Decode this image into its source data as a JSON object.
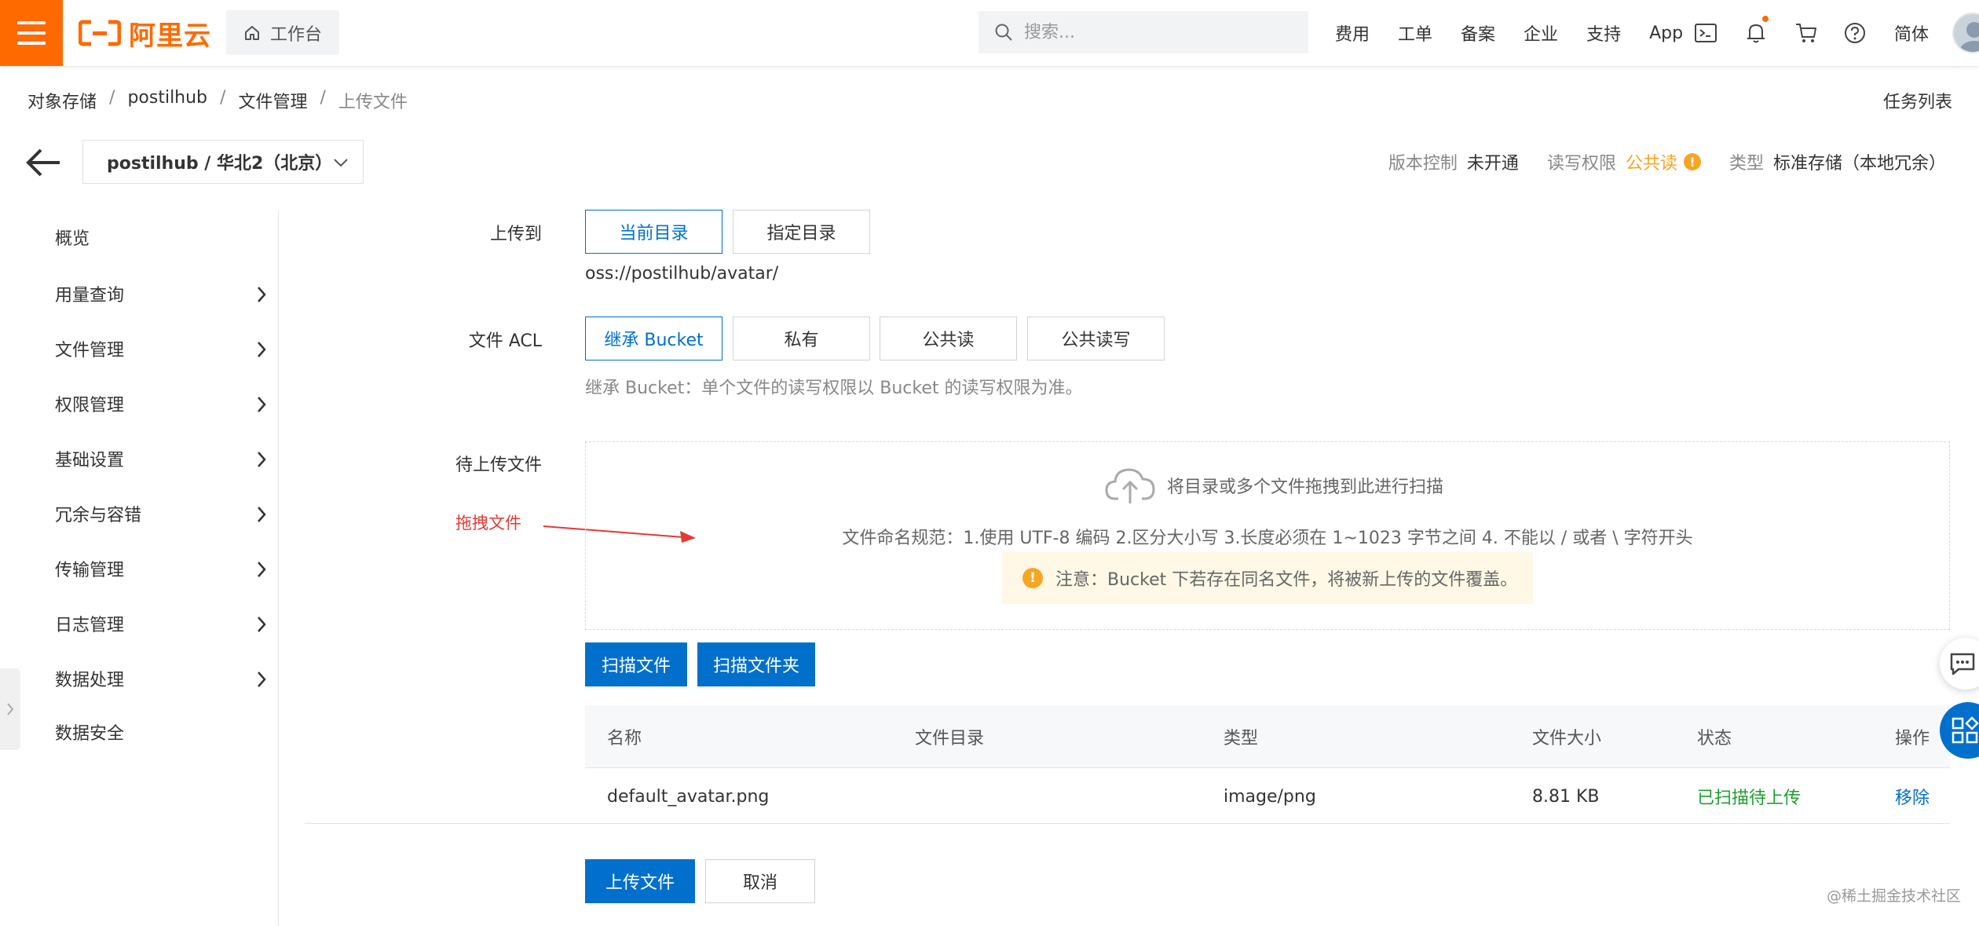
{
  "topbar": {
    "logo_text": "阿里云",
    "workbench_label": "工作台",
    "search_placeholder": "搜索...",
    "nav": [
      "费用",
      "工单",
      "备案",
      "企业",
      "支持",
      "App"
    ],
    "lang_label": "简体",
    "brand_color": "#ff6a00"
  },
  "breadcrumb": [
    "对象存储",
    "postilhub",
    "文件管理",
    "上传文件"
  ],
  "task_list_label": "任务列表",
  "bucket": {
    "selector_value": "postilhub / 华北2（北京）",
    "version_label": "版本控制",
    "version_value": "未开通",
    "acl_label": "读写权限",
    "acl_value": "公共读",
    "type_label": "类型",
    "type_value": "标准存储（本地冗余）"
  },
  "sidebar": {
    "items": [
      {
        "label": "概览",
        "has_arrow": false
      },
      {
        "label": "用量查询",
        "has_arrow": true
      },
      {
        "label": "文件管理",
        "has_arrow": true
      },
      {
        "label": "权限管理",
        "has_arrow": true
      },
      {
        "label": "基础设置",
        "has_arrow": true
      },
      {
        "label": "冗余与容错",
        "has_arrow": true
      },
      {
        "label": "传输管理",
        "has_arrow": true
      },
      {
        "label": "日志管理",
        "has_arrow": true
      },
      {
        "label": "数据处理",
        "has_arrow": true
      },
      {
        "label": "数据安全",
        "has_arrow": false
      }
    ]
  },
  "form": {
    "upload_to": {
      "label": "上传到",
      "options": [
        "当前目录",
        "指定目录"
      ],
      "selected": "当前目录",
      "path": "oss://postilhub/avatar/"
    },
    "acl": {
      "label": "文件 ACL",
      "options": [
        "继承 Bucket",
        "私有",
        "公共读",
        "公共读写"
      ],
      "selected": "继承 Bucket",
      "hint": "继承 Bucket：单个文件的读写权限以 Bucket 的读写权限为准。"
    },
    "pending": {
      "label": "待上传文件",
      "drop_text": "将目录或多个文件拖拽到此进行扫描",
      "rules": "文件命名规范：1.使用 UTF-8 编码 2.区分大小写 3.长度必须在 1~1023 字节之间 4. 不能以 / 或者 \\ 字符开头",
      "note": "注意：Bucket 下若存在同名文件，将被新上传的文件覆盖。",
      "annotation": "拖拽文件"
    },
    "scan_file_label": "扫描文件",
    "scan_folder_label": "扫描文件夹"
  },
  "table": {
    "headers": [
      "名称",
      "文件目录",
      "类型",
      "文件大小",
      "状态",
      "操作"
    ],
    "rows": [
      {
        "name": "default_avatar.png",
        "dir": "",
        "type": "image/png",
        "size": "8.81 KB",
        "status": "已扫描待上传",
        "action": "移除"
      }
    ],
    "status_color": "#1e9e2f"
  },
  "actions": {
    "upload_label": "上传文件",
    "cancel_label": "取消"
  },
  "watermark": "@稀土掘金技术社区",
  "primary_color": "#0070cc"
}
